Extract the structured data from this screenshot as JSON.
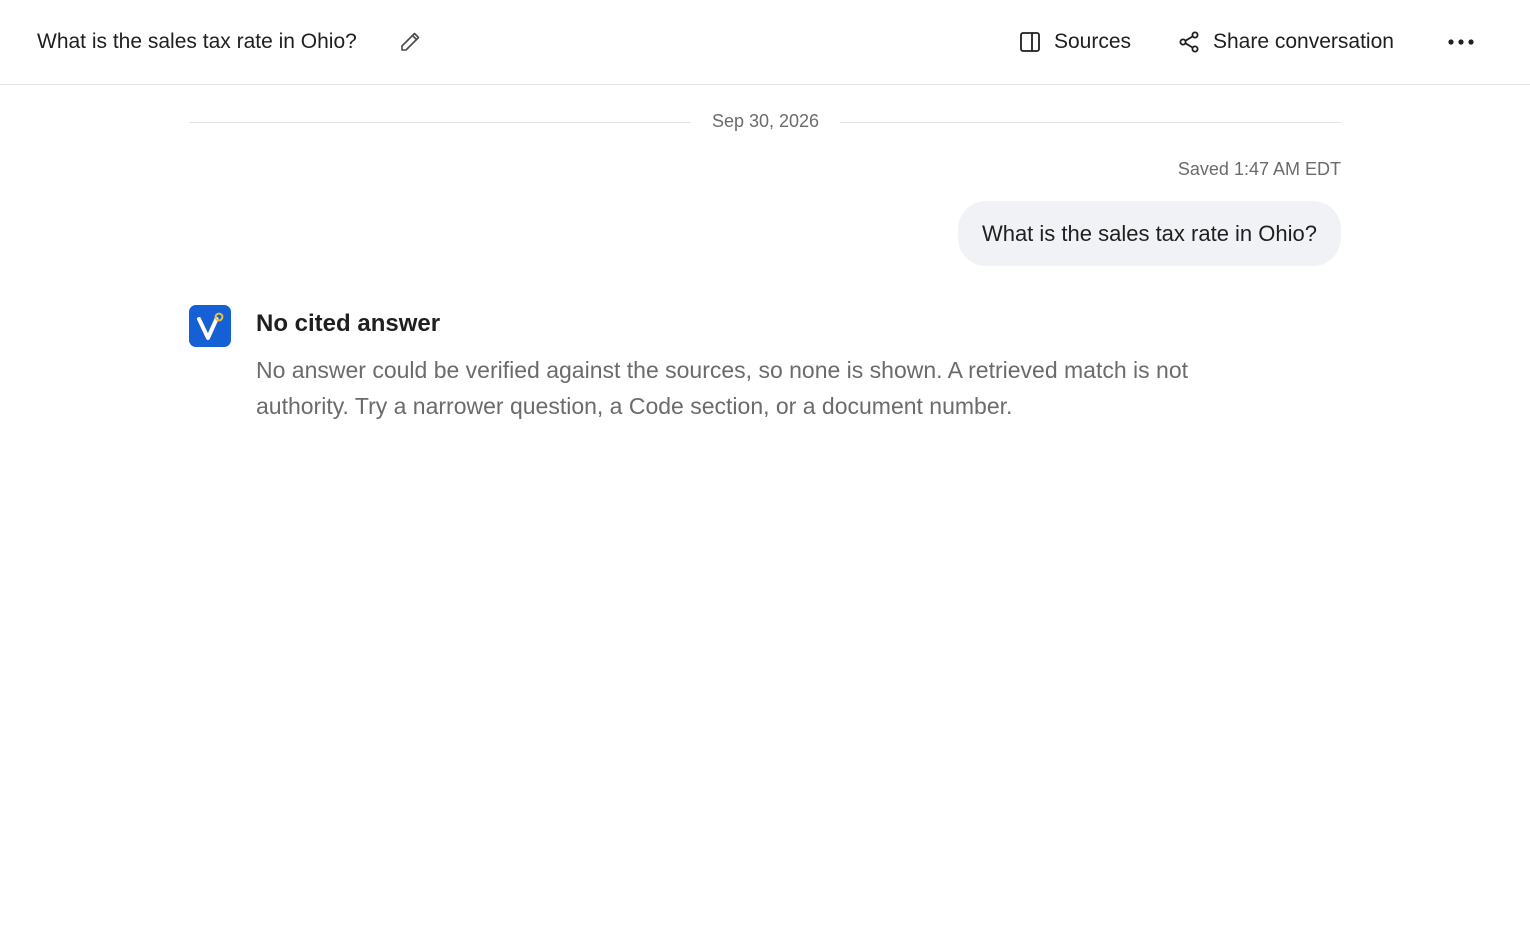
{
  "header": {
    "title": "What is the sales tax rate in Ohio?",
    "sources_label": "Sources",
    "share_label": "Share conversation"
  },
  "conversation": {
    "date": "Sep 30, 2026",
    "saved_status": "Saved 1:47 AM EDT",
    "user_message": "What is the sales tax rate in Ohio?",
    "assistant": {
      "title": "No cited answer",
      "body": "No answer could be verified against the sources, so none is shown. A retrieved match is not authority. Try a narrower question, a Code section, or a document number."
    }
  },
  "icons": {
    "edit": "pencil-icon",
    "sources": "side-panel-icon",
    "share": "share-nodes-icon",
    "more": "more-horizontal-icon",
    "avatar": "assistant-logo-icon"
  },
  "colors": {
    "accent": "#1560d4",
    "avatar_dot": "#f2c230",
    "bubble": "#f1f2f5",
    "muted_text": "#6b6b6b"
  }
}
